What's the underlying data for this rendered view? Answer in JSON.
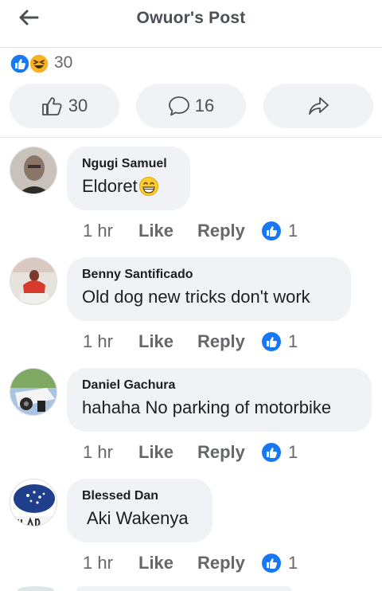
{
  "header": {
    "title": "Owuor's Post"
  },
  "post": {
    "reaction_count": "30",
    "reaction_icons": [
      "like-icon",
      "haha-icon"
    ],
    "actions": {
      "like_count": "30",
      "comment_count": "16",
      "share_icon": "share-icon"
    }
  },
  "comments": [
    {
      "author": "Ngugi Samuel",
      "text": "Eldoret",
      "emoji": "grin-emoji",
      "time": "1 hr",
      "like_label": "Like",
      "reply_label": "Reply",
      "reactions": "1"
    },
    {
      "author": "Benny Santificado",
      "text": "Old dog new tricks don't work",
      "time": "1 hr",
      "like_label": "Like",
      "reply_label": "Reply",
      "reactions": "1"
    },
    {
      "author": "Daniel Gachura",
      "text": "hahaha No parking of motorbike",
      "time": "1 hr",
      "like_label": "Like",
      "reply_label": "Reply",
      "reactions": "1"
    },
    {
      "author": "Blessed Dan",
      "text": "Aki Wakenya",
      "time": "1 hr",
      "like_label": "Like",
      "reply_label": "Reply",
      "reactions": "1"
    }
  ],
  "colors": {
    "facebook_blue": "#1877f2",
    "bubble_bg": "#f0f2f5",
    "meta_gray": "#65676b"
  }
}
